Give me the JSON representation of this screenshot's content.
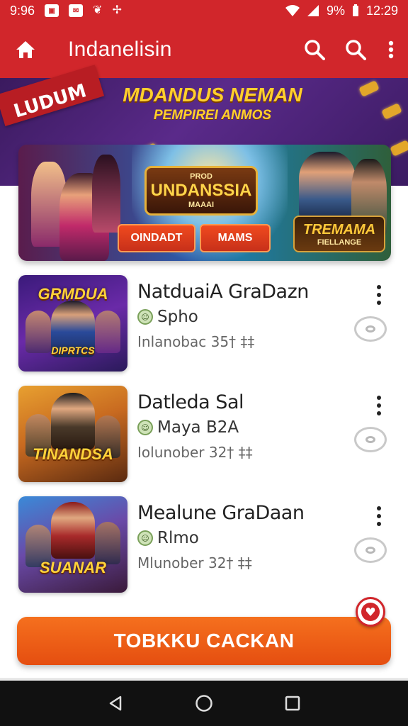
{
  "status_bar": {
    "time_left": "9:96",
    "battery": "9%",
    "clock": "12:29"
  },
  "app_bar": {
    "title": "Indanelisin"
  },
  "promo": {
    "ribbon": "LUDUM",
    "title": "MDANDUS NEMAN",
    "subtitle": "PEMPIREI ANMOS"
  },
  "hero": {
    "logo_top": "PROD",
    "logo_title": "UNDANSSIA",
    "logo_sub": "MAAAI",
    "button_1": "OINDADT",
    "button_2": "MAMS",
    "badge_title": "TREMAMA",
    "badge_sub": "FIELLANGE"
  },
  "list": [
    {
      "thumb_label": "GRMDUA",
      "thumb_bottom": "DIPRTCS",
      "title": "NatduaiA GraDazn",
      "developer": "Spho",
      "meta": "Inlanobac 35† ‡‡"
    },
    {
      "thumb_label": "",
      "thumb_bottom": "TINANDSA",
      "title": "Datleda Sal",
      "developer": "Maya B2A",
      "meta": "Iolunober 32† ‡‡"
    },
    {
      "thumb_label": "",
      "thumb_bottom": "SUANAR",
      "title": "Mealune GraDaan",
      "developer": "Rlmo",
      "meta": "Mlunober 32† ‡‡"
    }
  ],
  "cta": {
    "label": "TOBKKU CACKAN"
  },
  "colors": {
    "primary": "#d1262b",
    "cta": "#ef5f18",
    "text": "#222222"
  }
}
